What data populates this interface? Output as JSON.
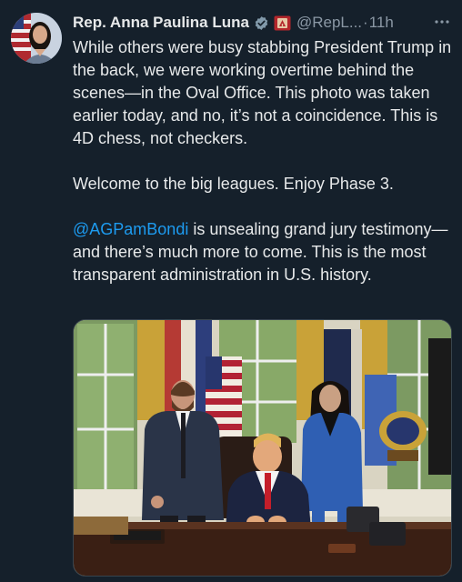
{
  "tweet": {
    "display_name": "Rep. Anna Paulina Luna",
    "handle": "@RepL...",
    "separator": "·",
    "time": "11h",
    "more_icon": "more-horizontal-icon",
    "badges": [
      "verified-badge-icon",
      "government-seal-badge-icon"
    ],
    "paragraph_1": "While others were busy stabbing President Trump in the back, we were working overtime behind the scenes—in the Oval Office. This photo was taken earlier today, and no, it’s not a coincidence. This is 4D chess, not checkers.",
    "paragraph_2": "Welcome to the big leagues. Enjoy Phase 3.",
    "mention": "@AGPamBondi",
    "paragraph_3_rest": " is unsealing grand jury testimony—and there’s much more to come. This is the most transparent administration in U.S. history.",
    "photo_description_icon": "oval-office-photo"
  },
  "colors": {
    "background": "#15202b",
    "text": "#e7e9ea",
    "muted": "#8b98a5",
    "link": "#1d9bf0"
  }
}
